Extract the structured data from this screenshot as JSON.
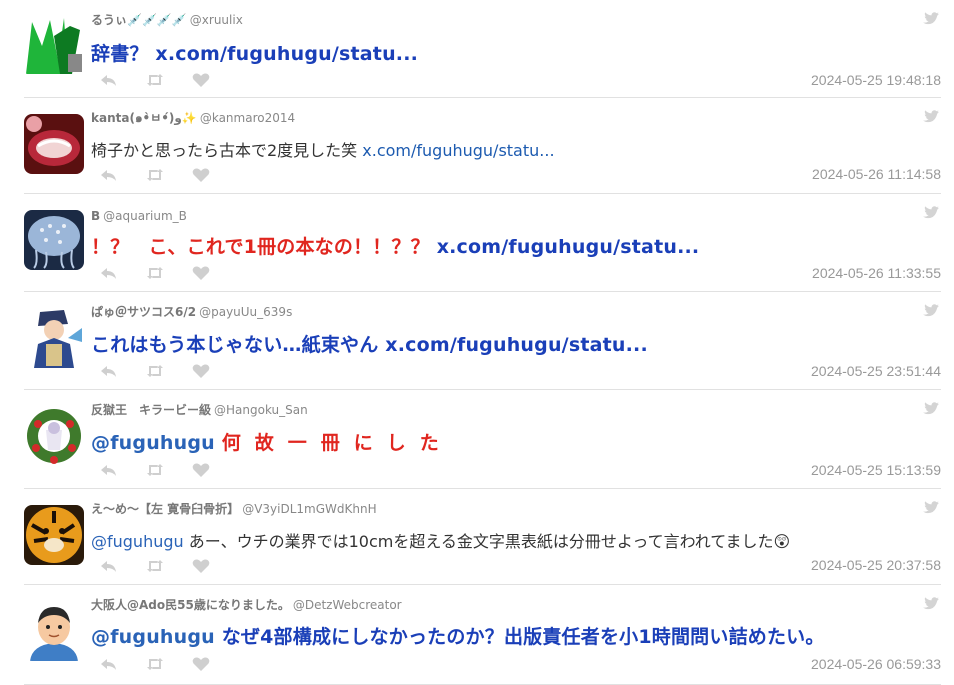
{
  "tweets": [
    {
      "name": "るうぃ💉💉💉💉",
      "handle": "@xruulix",
      "body_style": "big",
      "segments": [
        {
          "text": "辞書？ ",
          "cls": "blue"
        },
        {
          "text": "x.com/fuguhugu/statu...",
          "cls": "blue"
        }
      ],
      "time": "2024-05-25 19:48:18",
      "avatar": "green-letters"
    },
    {
      "name": "kanta(๑•̀ㅂ•́)و✨",
      "handle": "@kanmaro2014",
      "body_style": "small",
      "segments": [
        {
          "text": "椅子かと思ったら古本で2度見した笑 ",
          "cls": ""
        },
        {
          "text": "x.com/fuguhugu/statu...",
          "cls": "link"
        }
      ],
      "time": "2024-05-26 11:14:58",
      "avatar": "red-closeup"
    },
    {
      "name": "B",
      "handle": "@aquarium_B",
      "body_style": "big",
      "segments": [
        {
          "text": "！？　こ、これで1冊の本なの！！？？ ",
          "cls": "red"
        },
        {
          "text": "x.com/fuguhugu/statu...",
          "cls": "blue"
        }
      ],
      "time": "2024-05-26 11:33:55",
      "avatar": "jellyfish"
    },
    {
      "name": "ぱゅ＠サツコス6/2",
      "handle": "@payuUu_639s",
      "body_style": "big",
      "segments": [
        {
          "text": "これはもう本じゃない…紙束やん ",
          "cls": "blue"
        },
        {
          "text": "x.com/fuguhugu/statu...",
          "cls": "blue"
        }
      ],
      "time": "2024-05-25 23:51:44",
      "avatar": "anime-character"
    },
    {
      "name": "反獄王　キラービー級",
      "handle": "@Hangoku_San",
      "body_style": "big",
      "segments": [
        {
          "text": "@fuguhugu ",
          "cls": "mention"
        },
        {
          "text": "何故一冊にした",
          "cls": "red spaced"
        }
      ],
      "time": "2024-05-25 15:13:59",
      "avatar": "wreath"
    },
    {
      "name": "え～め～【左 寛骨臼骨折】",
      "handle": "@V3yiDL1mGWdKhnH",
      "body_style": "small",
      "segments": [
        {
          "text": "@fuguhugu",
          "cls": "mention"
        },
        {
          "text": " あー、ウチの業界では10cmを超える金文字黒表紙は分冊せよって言われてました😲",
          "cls": ""
        }
      ],
      "time": "2024-05-25 20:37:58",
      "avatar": "tiger"
    },
    {
      "name": "大阪人@Ado民55歳になりました。",
      "handle": "@DetzWebcreator",
      "body_style": "big",
      "segments": [
        {
          "text": "@fuguhugu ",
          "cls": "mention"
        },
        {
          "text": "なぜ4部構成にしなかったのか？出版責任者を小1時間問い詰めたい。",
          "cls": "blue"
        }
      ],
      "time": "2024-05-26 06:59:33",
      "avatar": "cartoon-man"
    }
  ],
  "icons": {
    "reply": "reply-icon",
    "retweet": "retweet-icon",
    "like": "heart-icon",
    "source": "twitter-bird-icon"
  },
  "colors": {
    "blue_text": "#1a3fb8",
    "red_text": "#e0261f",
    "link": "#1d5bb0",
    "timestamp": "#999999",
    "divider": "#e1e1e1"
  }
}
